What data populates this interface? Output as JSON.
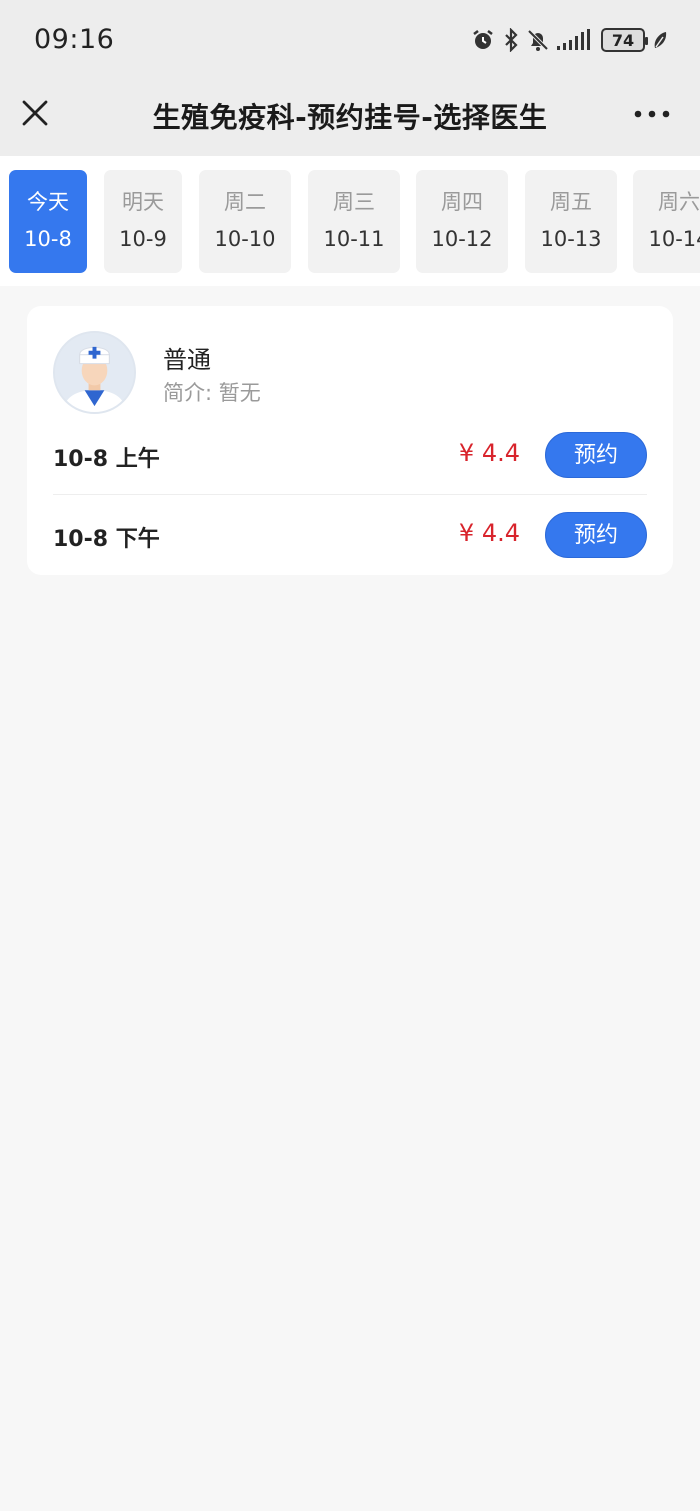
{
  "status": {
    "time": "09:16",
    "battery": "74",
    "icons": [
      "alarm-icon",
      "bluetooth-icon",
      "mute-bell-icon",
      "signal-icon",
      "battery-icon",
      "leaf-icon"
    ]
  },
  "nav": {
    "title": "生殖免疫科-预约挂号-选择医生",
    "close_icon": "close-icon",
    "more_icon": "more-icon"
  },
  "dates": [
    {
      "dow": "今天",
      "date": "10-8",
      "active": true
    },
    {
      "dow": "明天",
      "date": "10-9",
      "active": false
    },
    {
      "dow": "周二",
      "date": "10-10",
      "active": false
    },
    {
      "dow": "周三",
      "date": "10-11",
      "active": false
    },
    {
      "dow": "周四",
      "date": "10-12",
      "active": false
    },
    {
      "dow": "周五",
      "date": "10-13",
      "active": false
    },
    {
      "dow": "周六",
      "date": "10-14",
      "active": false
    }
  ],
  "doctor": {
    "name": "普通",
    "intro": "简介: 暂无",
    "slots": [
      {
        "time": "10-8 上午",
        "price": "¥ 4.4",
        "button": "预约"
      },
      {
        "time": "10-8 下午",
        "price": "¥ 4.4",
        "button": "预约"
      }
    ]
  },
  "colors": {
    "accent": "#3578ee",
    "price": "#d8242c",
    "bar_bg": "#ededed",
    "page_bg": "#f7f7f7"
  }
}
